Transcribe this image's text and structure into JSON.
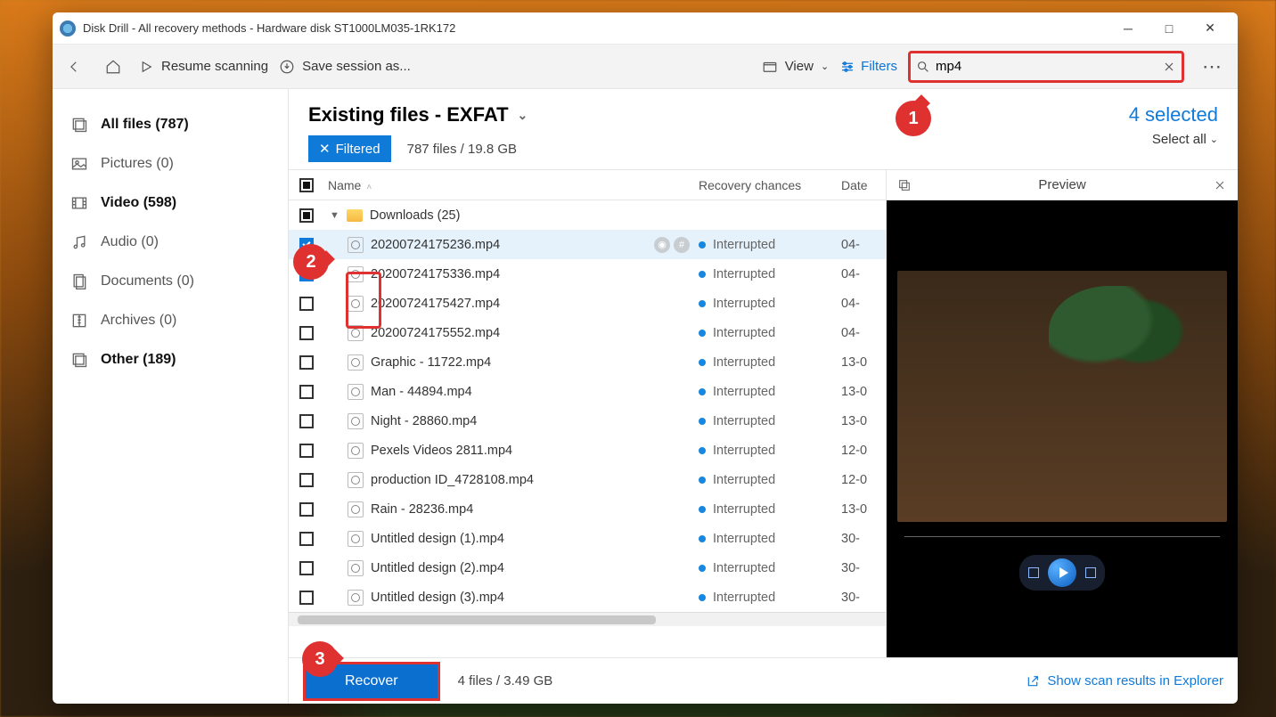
{
  "title": "Disk Drill - All recovery methods - Hardware disk ST1000LM035-1RK172",
  "toolbar": {
    "resume": "Resume scanning",
    "save_session": "Save session as...",
    "view": "View",
    "filters": "Filters"
  },
  "search": {
    "value": "mp4"
  },
  "sidebar": {
    "items": [
      {
        "label": "All files (787)"
      },
      {
        "label": "Pictures (0)"
      },
      {
        "label": "Video (598)"
      },
      {
        "label": "Audio (0)"
      },
      {
        "label": "Documents (0)"
      },
      {
        "label": "Archives (0)"
      },
      {
        "label": "Other (189)"
      }
    ]
  },
  "main": {
    "heading": "Existing files - EXFAT",
    "filtered_label": "Filtered",
    "count_text": "787 files / 19.8 GB",
    "selected_text": "4 selected",
    "select_all": "Select all"
  },
  "columns": {
    "name": "Name",
    "recovery": "Recovery chances",
    "date": "Date"
  },
  "folder": {
    "name": "Downloads (25)"
  },
  "files": [
    {
      "name": "20200724175236.mp4",
      "rec": "Interrupted",
      "date": "04-",
      "checked": true,
      "sel": true,
      "icons": true
    },
    {
      "name": "20200724175336.mp4",
      "rec": "Interrupted",
      "date": "04-",
      "checked": true,
      "sel": false
    },
    {
      "name": "20200724175427.mp4",
      "rec": "Interrupted",
      "date": "04-",
      "checked": false
    },
    {
      "name": "20200724175552.mp4",
      "rec": "Interrupted",
      "date": "04-",
      "checked": false
    },
    {
      "name": "Graphic - 11722.mp4",
      "rec": "Interrupted",
      "date": "13-0",
      "checked": false
    },
    {
      "name": "Man - 44894.mp4",
      "rec": "Interrupted",
      "date": "13-0",
      "checked": false
    },
    {
      "name": "Night - 28860.mp4",
      "rec": "Interrupted",
      "date": "13-0",
      "checked": false
    },
    {
      "name": "Pexels Videos 2811.mp4",
      "rec": "Interrupted",
      "date": "12-0",
      "checked": false
    },
    {
      "name": "production ID_4728108.mp4",
      "rec": "Interrupted",
      "date": "12-0",
      "checked": false
    },
    {
      "name": "Rain - 28236.mp4",
      "rec": "Interrupted",
      "date": "13-0",
      "checked": false
    },
    {
      "name": "Untitled design (1).mp4",
      "rec": "Interrupted",
      "date": "30-",
      "checked": false
    },
    {
      "name": "Untitled design (2).mp4",
      "rec": "Interrupted",
      "date": "30-",
      "checked": false
    },
    {
      "name": "Untitled design (3).mp4",
      "rec": "Interrupted",
      "date": "30-",
      "checked": false
    }
  ],
  "preview": {
    "label": "Preview"
  },
  "footer": {
    "recover": "Recover",
    "info": "4 files / 3.49 GB",
    "show_explorer": "Show scan results in Explorer"
  },
  "callouts": {
    "c1": "1",
    "c2": "2",
    "c3": "3"
  }
}
